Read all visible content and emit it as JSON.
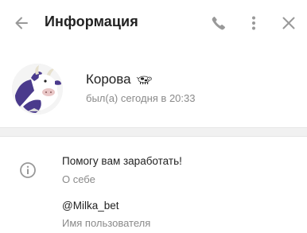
{
  "header": {
    "title": "Информация",
    "back_icon": "arrow-left-icon",
    "call_icon": "phone-icon",
    "more_icon": "more-vertical-icon",
    "close_icon": "close-icon"
  },
  "profile": {
    "name": "Корова",
    "name_emoji": "cow-emoji",
    "status": "был(а) сегодня в 20:33",
    "avatar": "cow-avatar"
  },
  "info": {
    "icon": "info-icon",
    "bio": "Помогу вам заработать!",
    "bio_label": "О себе",
    "username": "@Milka_bet",
    "username_label": "Имя пользователя"
  },
  "colors": {
    "text": "#222222",
    "secondary_text": "#8a8a8a",
    "icon": "#999999",
    "divider": "#f1f1f1",
    "avatar_purple": "#4a3a8c"
  }
}
